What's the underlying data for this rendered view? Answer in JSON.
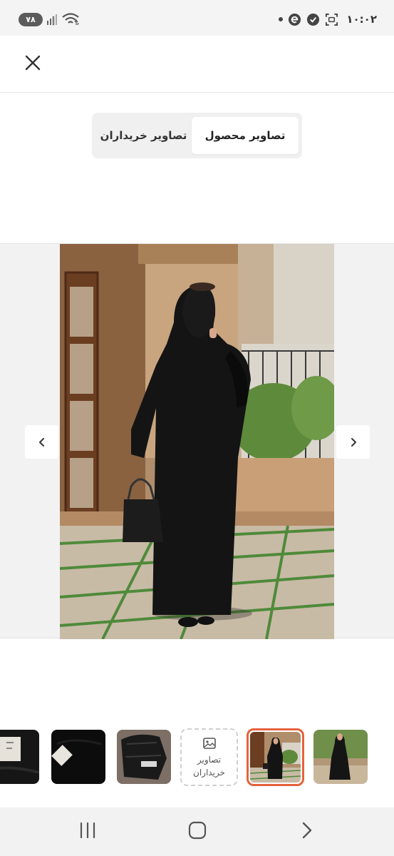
{
  "status_bar": {
    "battery": "۷۸",
    "time": "۱۰:۰۲",
    "icons": [
      "signal-icon",
      "wifi-icon",
      "notification-dot-icon",
      "app-e-icon",
      "shield-check-icon",
      "screenshot-icon"
    ]
  },
  "header": {
    "close_icon": "close-icon"
  },
  "tabs": [
    {
      "label": "تصاویر محصول",
      "active": true
    },
    {
      "label": "تصاویر خریداران",
      "active": false
    }
  ],
  "gallery": {
    "prev_icon": "chevron-left-icon",
    "next_icon": "chevron-right-icon"
  },
  "thumbnails": {
    "buyers_label": "تصاویر خریداران",
    "buyers_icon": "image-icon",
    "selected_index": 1
  },
  "nav_bar": {
    "icons": [
      "recent-apps-icon",
      "home-icon",
      "back-icon"
    ]
  },
  "colors": {
    "accent": "#e5623c",
    "tab_bg": "#f0f0f0"
  }
}
